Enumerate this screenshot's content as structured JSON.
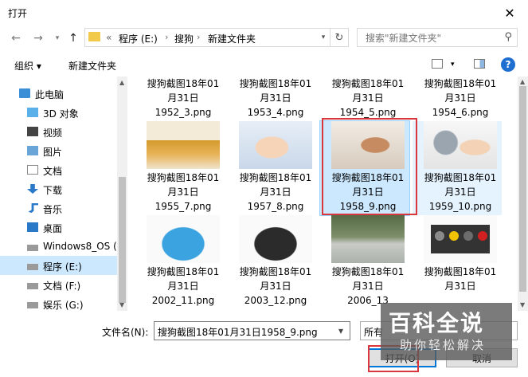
{
  "window": {
    "title": "打开"
  },
  "address": {
    "root_chevron": "«",
    "crumbs": [
      "程序 (E:)",
      "搜狗",
      "新建文件夹"
    ]
  },
  "search": {
    "placeholder": "搜索\"新建文件夹\""
  },
  "toolbar": {
    "organize": "组织 ▾",
    "new_folder": "新建文件夹"
  },
  "nav": {
    "items": [
      {
        "label": "此电脑",
        "icon": "computer-icon"
      },
      {
        "label": "3D 对象",
        "icon": "3d-objects-icon"
      },
      {
        "label": "视频",
        "icon": "video-icon"
      },
      {
        "label": "图片",
        "icon": "pictures-icon"
      },
      {
        "label": "文档",
        "icon": "documents-icon"
      },
      {
        "label": "下载",
        "icon": "download-icon"
      },
      {
        "label": "音乐",
        "icon": "music-icon"
      },
      {
        "label": "桌面",
        "icon": "desktop-icon"
      },
      {
        "label": "Windows8_OS (C",
        "icon": "drive-icon"
      },
      {
        "label": "程序 (E:)",
        "icon": "drive-icon",
        "selected": true
      },
      {
        "label": "文档 (F:)",
        "icon": "drive-icon"
      },
      {
        "label": "娱乐 (G:)",
        "icon": "drive-icon"
      }
    ]
  },
  "files": [
    {
      "line1": "搜狗截图18年01",
      "line2": "月31日",
      "line3": "1952_3.png"
    },
    {
      "line1": "搜狗截图18年01",
      "line2": "月31日",
      "line3": "1953_4.png"
    },
    {
      "line1": "搜狗截图18年01",
      "line2": "月31日",
      "line3": "1954_5.png"
    },
    {
      "line1": "搜狗截图18年01",
      "line2": "月31日",
      "line3": "1954_6.png"
    },
    {
      "line1": "搜狗截图18年01",
      "line2": "月31日",
      "line3": "1955_7.png"
    },
    {
      "line1": "搜狗截图18年01",
      "line2": "月31日",
      "line3": "1957_8.png"
    },
    {
      "line1": "搜狗截图18年01",
      "line2": "月31日",
      "line3": "1958_9.png",
      "selected": true
    },
    {
      "line1": "搜狗截图18年01",
      "line2": "月31日",
      "line3": "1959_10.png"
    },
    {
      "line1": "搜狗截图18年01",
      "line2": "月31日",
      "line3": "2002_11.png"
    },
    {
      "line1": "搜狗截图18年01",
      "line2": "月31日",
      "line3": "2003_12.png"
    },
    {
      "line1": "搜狗截图18年01",
      "line2": "月31日",
      "line3": "2006_13"
    },
    {
      "line1": "搜狗截图18年01",
      "line2": "月31日",
      "line3": ""
    }
  ],
  "bottom": {
    "filename_label": "文件名(N):",
    "filename_value": "搜狗截图18年01月31日1958_9.png",
    "filetype_value": "所有",
    "open_button": "打开(O)",
    "cancel_button": "取消"
  },
  "watermark": {
    "logo": "百科全说",
    "sub": "助你轻松解决"
  },
  "colors": {
    "accent": "#0078d7",
    "selection": "#cce8ff",
    "highlight_box": "#d9363e"
  }
}
